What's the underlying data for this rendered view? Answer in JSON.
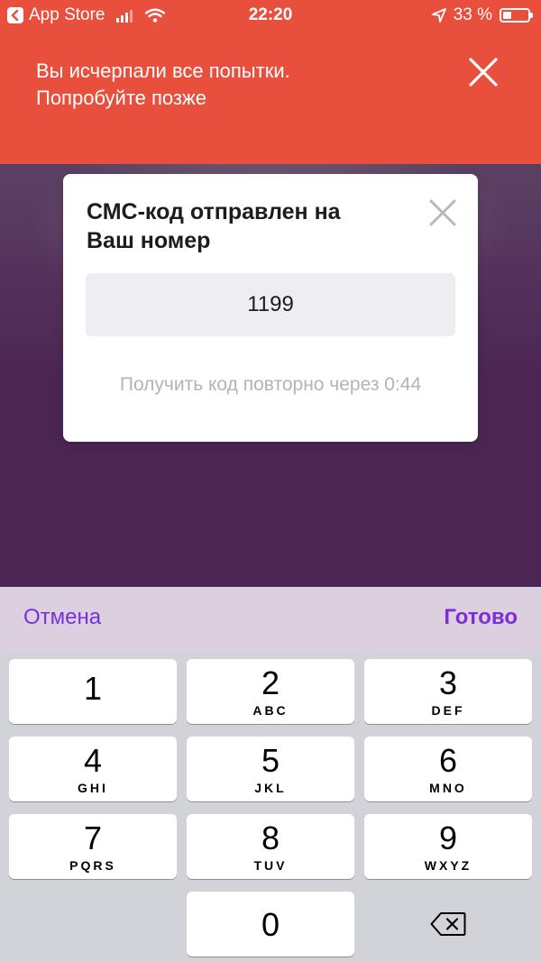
{
  "status_bar": {
    "back_app": "App Store",
    "time": "22:20",
    "battery": "33 %",
    "battery_level": 0.33
  },
  "error_banner": {
    "line1": "Вы исчерпали все попытки.",
    "line2": "Попробуйте позже",
    "close_icon": "close-icon"
  },
  "modal": {
    "title_line1": "СМС-код отправлен на",
    "title_line2": "Ваш номер",
    "code_value": "1199",
    "resend_text": "Получить код повторно через 0:44",
    "close_icon": "close-icon"
  },
  "keyboard_toolbar": {
    "cancel": "Отмена",
    "done": "Готово"
  },
  "keypad": {
    "keys": [
      {
        "num": "1",
        "letters": ""
      },
      {
        "num": "2",
        "letters": "ABC"
      },
      {
        "num": "3",
        "letters": "DEF"
      },
      {
        "num": "4",
        "letters": "GHI"
      },
      {
        "num": "5",
        "letters": "JKL"
      },
      {
        "num": "6",
        "letters": "MNO"
      },
      {
        "num": "7",
        "letters": "PQRS"
      },
      {
        "num": "8",
        "letters": "TUV"
      },
      {
        "num": "9",
        "letters": "WXYZ"
      },
      {
        "num": "0",
        "letters": ""
      }
    ],
    "delete_icon": "backspace-icon"
  },
  "colors": {
    "banner": "#e84f3d",
    "accent": "#7c2fd6",
    "modal_bg": "#ffffff",
    "input_bg": "#eeeef2"
  }
}
